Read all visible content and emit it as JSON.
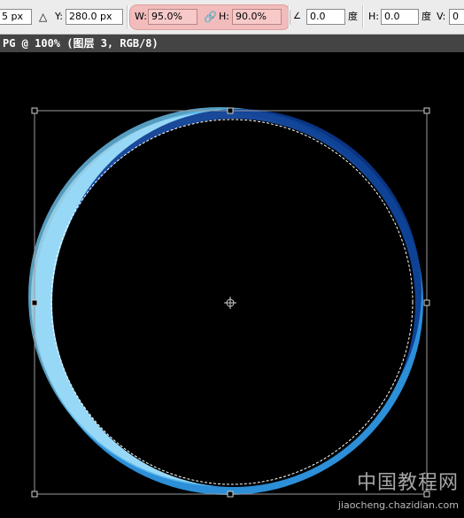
{
  "toolbar": {
    "x_value": "5 px",
    "y_label": "Y:",
    "y_value": "280.0 px",
    "w_label": "W:",
    "w_value": "95.0%",
    "h_label": "H:",
    "h_value": "90.0%",
    "angle_value": "0.0",
    "angle_unit": "度",
    "skew_h_label": "H:",
    "skew_h_value": "0.0",
    "skew_h_unit": "度",
    "skew_v_label": "V:",
    "skew_v_value": "0"
  },
  "document": {
    "title": "PG @ 100% (图层 3, RGB/8)"
  },
  "watermark": {
    "line1": "中国教程网",
    "line2": "jiaocheng.chazidian.com"
  },
  "colors": {
    "ring_light": "#bfefff",
    "ring_mid": "#3aa8e0",
    "ring_dark": "#0a3c9a",
    "highlight": "#f2bcbc"
  }
}
